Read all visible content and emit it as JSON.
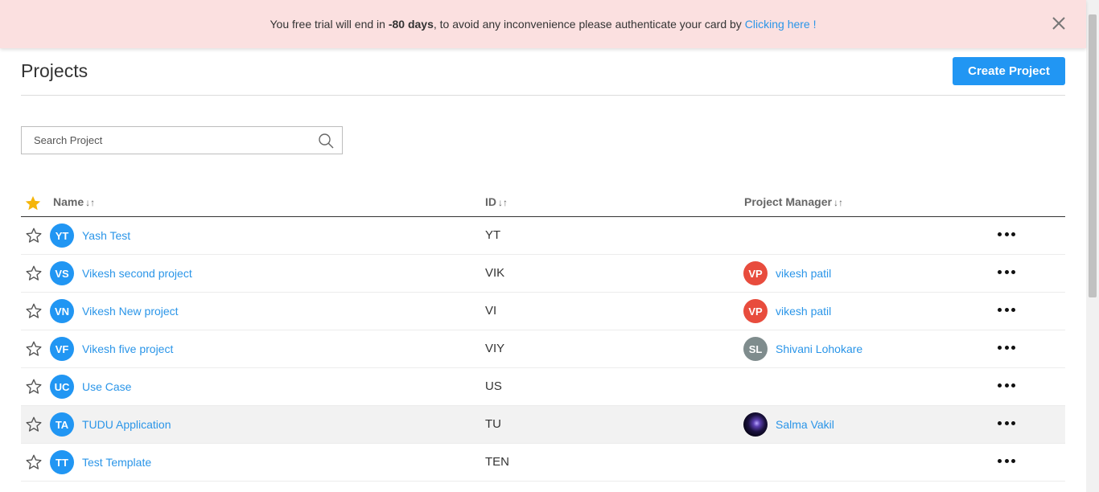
{
  "banner": {
    "text_before": "You free trial will end in ",
    "days": "-80 days",
    "text_after": ", to avoid any inconvenience please authenticate your card by",
    "link": "Clicking here !"
  },
  "header": {
    "title": "Projects",
    "create_label": "Create Project"
  },
  "search": {
    "placeholder": "Search Project"
  },
  "table": {
    "columns": {
      "name": "Name",
      "id": "ID",
      "manager": "Project Manager",
      "sort_glyph": "↓↑"
    },
    "rows": [
      {
        "initials": "YT",
        "name": "Yash Test",
        "id": "YT",
        "manager": "",
        "manager_initials": "",
        "manager_color": ""
      },
      {
        "initials": "VS",
        "name": "Vikesh second project",
        "id": "VIK",
        "manager": "vikesh patil",
        "manager_initials": "VP",
        "manager_color": "#e84c3d"
      },
      {
        "initials": "VN",
        "name": "Vikesh New project",
        "id": "VI",
        "manager": "vikesh patil",
        "manager_initials": "VP",
        "manager_color": "#e84c3d"
      },
      {
        "initials": "VF",
        "name": "Vikesh five project",
        "id": "VIY",
        "manager": "Shivani Lohokare",
        "manager_initials": "SL",
        "manager_color": "#7f8c8d"
      },
      {
        "initials": "UC",
        "name": "Use Case",
        "id": "US",
        "manager": "",
        "manager_initials": "",
        "manager_color": ""
      },
      {
        "initials": "TA",
        "name": "TUDU Application",
        "id": "TU",
        "manager": "Salma Vakil",
        "manager_initials": "",
        "manager_color": "photo"
      },
      {
        "initials": "TT",
        "name": "Test Template",
        "id": "TEN",
        "manager": "",
        "manager_initials": "",
        "manager_color": ""
      }
    ]
  },
  "colors": {
    "accent": "#2196f3",
    "link": "#2a95e8",
    "banner_bg": "#fbe0e0",
    "star_active": "#f5b50a"
  }
}
